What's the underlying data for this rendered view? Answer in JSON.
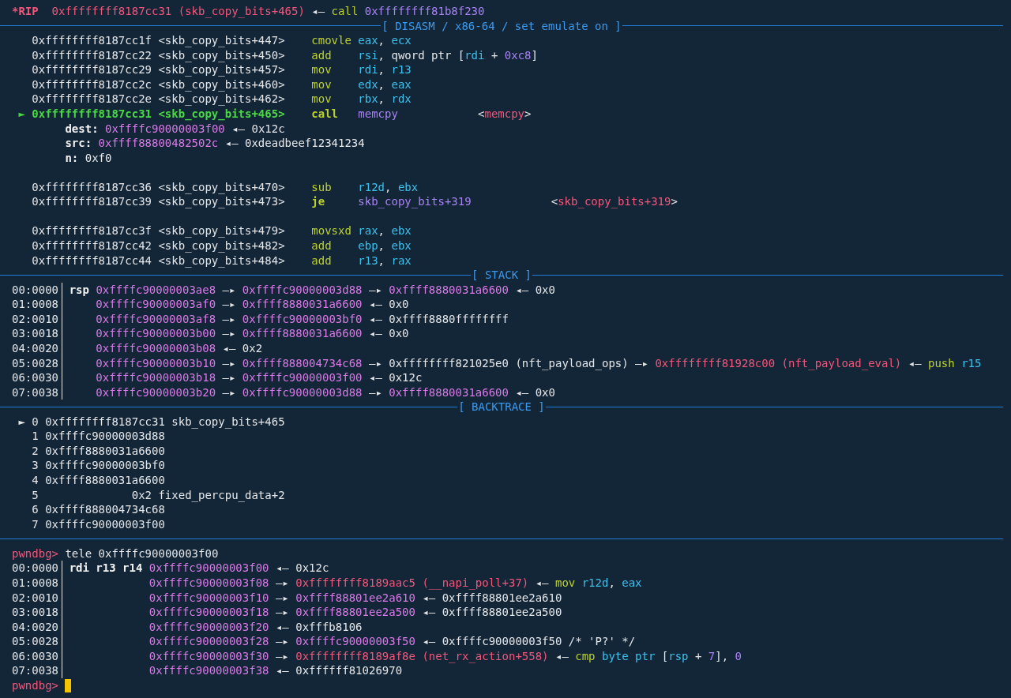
{
  "lines": [
    {
      "kind": "text",
      "segments": [
        {
          "text": "*RIP",
          "kind": "rip"
        },
        {
          "text": "  0xffffffff8187cc31 (skb_copy_bits+465)",
          "kind": "code"
        },
        {
          "text": " ◂— ",
          "kind": "plain"
        },
        {
          "text": "call",
          "kind": "mnem"
        },
        {
          "text": " 0xffffffff81b8f230",
          "kind": "imm"
        }
      ]
    },
    {
      "kind": "rule",
      "label": "[ DISASM / x86-64 / set emulate on ]"
    },
    {
      "kind": "text",
      "segments": [
        {
          "text": "   0xffffffff8187cc1f <skb_copy_bits+447>    ",
          "kind": "plain"
        },
        {
          "text": "cmovle ",
          "kind": "mnem"
        },
        {
          "text": "eax",
          "kind": "reg"
        },
        {
          "text": ", ",
          "kind": "plain"
        },
        {
          "text": "ecx",
          "kind": "reg"
        }
      ]
    },
    {
      "kind": "text",
      "segments": [
        {
          "text": "   0xffffffff8187cc22 <skb_copy_bits+450>    ",
          "kind": "plain"
        },
        {
          "text": "add    ",
          "kind": "mnem"
        },
        {
          "text": "rsi",
          "kind": "reg"
        },
        {
          "text": ", qword ptr [",
          "kind": "plain"
        },
        {
          "text": "rdi",
          "kind": "reg"
        },
        {
          "text": " + ",
          "kind": "plain"
        },
        {
          "text": "0xc8",
          "kind": "imm"
        },
        {
          "text": "]",
          "kind": "plain"
        }
      ]
    },
    {
      "kind": "text",
      "segments": [
        {
          "text": "   0xffffffff8187cc29 <skb_copy_bits+457>    ",
          "kind": "plain"
        },
        {
          "text": "mov    ",
          "kind": "mnem"
        },
        {
          "text": "rdi",
          "kind": "reg"
        },
        {
          "text": ", ",
          "kind": "plain"
        },
        {
          "text": "r13",
          "kind": "reg"
        }
      ]
    },
    {
      "kind": "text",
      "segments": [
        {
          "text": "   0xffffffff8187cc2c <skb_copy_bits+460>    ",
          "kind": "plain"
        },
        {
          "text": "mov    ",
          "kind": "mnem"
        },
        {
          "text": "edx",
          "kind": "reg"
        },
        {
          "text": ", ",
          "kind": "plain"
        },
        {
          "text": "eax",
          "kind": "reg"
        }
      ]
    },
    {
      "kind": "text",
      "segments": [
        {
          "text": "   0xffffffff8187cc2e <skb_copy_bits+462>    ",
          "kind": "plain"
        },
        {
          "text": "mov    ",
          "kind": "mnem"
        },
        {
          "text": "rbx",
          "kind": "reg"
        },
        {
          "text": ", ",
          "kind": "plain"
        },
        {
          "text": "rdx",
          "kind": "reg"
        }
      ]
    },
    {
      "kind": "text",
      "segments": [
        {
          "text": " ► 0xffffffff8187cc31 <skb_copy_bits+465>    ",
          "kind": "current"
        },
        {
          "text": "call   ",
          "kind": "mnembold"
        },
        {
          "text": "memcpy",
          "kind": "imm"
        },
        {
          "text": "            <",
          "kind": "plain"
        },
        {
          "text": "memcpy",
          "kind": "code"
        },
        {
          "text": ">",
          "kind": "plain"
        }
      ]
    },
    {
      "kind": "text",
      "segments": [
        {
          "text": "        dest: ",
          "kind": "bold"
        },
        {
          "text": "0xffffc90000003f00",
          "kind": "stack"
        },
        {
          "text": " ◂— 0x12c",
          "kind": "plain"
        }
      ]
    },
    {
      "kind": "text",
      "segments": [
        {
          "text": "        src: ",
          "kind": "bold"
        },
        {
          "text": "0xffff88800482502c",
          "kind": "stack"
        },
        {
          "text": " ◂— 0xdeadbeef12341234",
          "kind": "plain"
        }
      ]
    },
    {
      "kind": "text",
      "segments": [
        {
          "text": "        n:",
          "kind": "bold"
        },
        {
          "text": " 0xf0",
          "kind": "plain"
        }
      ]
    },
    {
      "kind": "blank"
    },
    {
      "kind": "text",
      "segments": [
        {
          "text": "   0xffffffff8187cc36 <skb_copy_bits+470>    ",
          "kind": "plain"
        },
        {
          "text": "sub    ",
          "kind": "mnem"
        },
        {
          "text": "r12d",
          "kind": "reg"
        },
        {
          "text": ", ",
          "kind": "plain"
        },
        {
          "text": "ebx",
          "kind": "reg"
        }
      ]
    },
    {
      "kind": "text",
      "segments": [
        {
          "text": "   0xffffffff8187cc39 <skb_copy_bits+473>    ",
          "kind": "plain"
        },
        {
          "text": "je     ",
          "kind": "mnembold"
        },
        {
          "text": "skb_copy_bits+319",
          "kind": "imm"
        },
        {
          "text": "            <",
          "kind": "plain"
        },
        {
          "text": "skb_copy_bits+319",
          "kind": "code"
        },
        {
          "text": ">",
          "kind": "plain"
        }
      ]
    },
    {
      "kind": "blank"
    },
    {
      "kind": "text",
      "segments": [
        {
          "text": "   0xffffffff8187cc3f <skb_copy_bits+479>    ",
          "kind": "plain"
        },
        {
          "text": "movsxd ",
          "kind": "mnem"
        },
        {
          "text": "rax",
          "kind": "reg"
        },
        {
          "text": ", ",
          "kind": "plain"
        },
        {
          "text": "ebx",
          "kind": "reg"
        }
      ]
    },
    {
      "kind": "text",
      "segments": [
        {
          "text": "   0xffffffff8187cc42 <skb_copy_bits+482>    ",
          "kind": "plain"
        },
        {
          "text": "add    ",
          "kind": "mnem"
        },
        {
          "text": "ebp",
          "kind": "reg"
        },
        {
          "text": ", ",
          "kind": "plain"
        },
        {
          "text": "ebx",
          "kind": "reg"
        }
      ]
    },
    {
      "kind": "text",
      "segments": [
        {
          "text": "   0xffffffff8187cc44 <skb_copy_bits+484>    ",
          "kind": "plain"
        },
        {
          "text": "add    ",
          "kind": "mnem"
        },
        {
          "text": "r13",
          "kind": "reg"
        },
        {
          "text": ", ",
          "kind": "plain"
        },
        {
          "text": "rax",
          "kind": "reg"
        }
      ]
    },
    {
      "kind": "rule",
      "label": "[ STACK ]"
    },
    {
      "kind": "gutter",
      "offset": "00:0000",
      "segments": [
        {
          "text": " rsp ",
          "kind": "bold"
        },
        {
          "text": "0xffffc90000003ae8",
          "kind": "stack"
        },
        {
          "text": " —▸ ",
          "kind": "plain"
        },
        {
          "text": "0xffffc90000003d88",
          "kind": "stack"
        },
        {
          "text": " —▸ ",
          "kind": "plain"
        },
        {
          "text": "0xffff8880031a6600",
          "kind": "stack"
        },
        {
          "text": " ◂— 0x0",
          "kind": "plain"
        }
      ]
    },
    {
      "kind": "gutter",
      "offset": "01:0008",
      "segments": [
        {
          "text": "     0xffffc90000003af0",
          "kind": "stack"
        },
        {
          "text": " —▸ ",
          "kind": "plain"
        },
        {
          "text": "0xffff8880031a6600",
          "kind": "stack"
        },
        {
          "text": " ◂— 0x0",
          "kind": "plain"
        }
      ]
    },
    {
      "kind": "gutter",
      "offset": "02:0010",
      "segments": [
        {
          "text": "     0xffffc90000003af8",
          "kind": "stack"
        },
        {
          "text": " —▸ ",
          "kind": "plain"
        },
        {
          "text": "0xffffc90000003bf0",
          "kind": "stack"
        },
        {
          "text": " ◂— 0xffff8880ffffffff",
          "kind": "plain"
        }
      ]
    },
    {
      "kind": "gutter",
      "offset": "03:0018",
      "segments": [
        {
          "text": "     0xffffc90000003b00",
          "kind": "stack"
        },
        {
          "text": " —▸ ",
          "kind": "plain"
        },
        {
          "text": "0xffff8880031a6600",
          "kind": "stack"
        },
        {
          "text": " ◂— 0x0",
          "kind": "plain"
        }
      ]
    },
    {
      "kind": "gutter",
      "offset": "04:0020",
      "segments": [
        {
          "text": "     0xffffc90000003b08",
          "kind": "stack"
        },
        {
          "text": " ◂— 0x2",
          "kind": "plain"
        }
      ]
    },
    {
      "kind": "gutter",
      "offset": "05:0028",
      "segments": [
        {
          "text": "     0xffffc90000003b10",
          "kind": "stack"
        },
        {
          "text": " —▸ ",
          "kind": "plain"
        },
        {
          "text": "0xffff888004734c68",
          "kind": "stack"
        },
        {
          "text": " —▸ 0xffffffff821025e0 (nft_payload_ops) —▸ ",
          "kind": "plain"
        },
        {
          "text": "0xffffffff81928c00 (nft_payload_eval)",
          "kind": "code"
        },
        {
          "text": " ◂— ",
          "kind": "plain"
        },
        {
          "text": "push ",
          "kind": "mnem"
        },
        {
          "text": "r15",
          "kind": "reg"
        }
      ]
    },
    {
      "kind": "gutter",
      "offset": "06:0030",
      "segments": [
        {
          "text": "     0xffffc90000003b18",
          "kind": "stack"
        },
        {
          "text": " —▸ ",
          "kind": "plain"
        },
        {
          "text": "0xffffc90000003f00",
          "kind": "stack"
        },
        {
          "text": " ◂— 0x12c",
          "kind": "plain"
        }
      ]
    },
    {
      "kind": "gutter",
      "offset": "07:0038",
      "segments": [
        {
          "text": "     0xffffc90000003b20",
          "kind": "stack"
        },
        {
          "text": " —▸ ",
          "kind": "plain"
        },
        {
          "text": "0xffffc90000003d88",
          "kind": "stack"
        },
        {
          "text": " —▸ ",
          "kind": "plain"
        },
        {
          "text": "0xffff8880031a6600",
          "kind": "stack"
        },
        {
          "text": " ◂— 0x0",
          "kind": "plain"
        }
      ]
    },
    {
      "kind": "rule",
      "label": "[ BACKTRACE ]"
    },
    {
      "kind": "text",
      "segments": [
        {
          "text": " ► 0 0xffffffff8187cc31 skb_copy_bits+465",
          "kind": "plain"
        }
      ]
    },
    {
      "kind": "text",
      "segments": [
        {
          "text": "   1 0xffffc90000003d88",
          "kind": "plain"
        }
      ]
    },
    {
      "kind": "text",
      "segments": [
        {
          "text": "   2 0xffff8880031a6600",
          "kind": "plain"
        }
      ]
    },
    {
      "kind": "text",
      "segments": [
        {
          "text": "   3 0xffffc90000003bf0",
          "kind": "plain"
        }
      ]
    },
    {
      "kind": "text",
      "segments": [
        {
          "text": "   4 0xffff8880031a6600",
          "kind": "plain"
        }
      ]
    },
    {
      "kind": "text",
      "segments": [
        {
          "text": "   5              0x2 fixed_percpu_data+2",
          "kind": "plain"
        }
      ]
    },
    {
      "kind": "text",
      "segments": [
        {
          "text": "   6 0xffff888004734c68",
          "kind": "plain"
        }
      ]
    },
    {
      "kind": "text",
      "segments": [
        {
          "text": "   7 0xffffc90000003f00",
          "kind": "plain"
        }
      ]
    },
    {
      "kind": "rule"
    },
    {
      "kind": "text",
      "segments": [
        {
          "text": "pwndbg>",
          "kind": "prompt"
        },
        {
          "text": " tele 0xffffc90000003f00",
          "kind": "plain"
        }
      ]
    },
    {
      "kind": "gutter",
      "offset": "00:0000",
      "segments": [
        {
          "text": " rdi r13 r14 ",
          "kind": "bold"
        },
        {
          "text": "0xffffc90000003f00",
          "kind": "stack"
        },
        {
          "text": " ◂— 0x12c",
          "kind": "plain"
        }
      ]
    },
    {
      "kind": "gutter",
      "offset": "01:0008",
      "segments": [
        {
          "text": "             0xffffc90000003f08",
          "kind": "stack"
        },
        {
          "text": " —▸ ",
          "kind": "plain"
        },
        {
          "text": "0xffffffff8189aac5 (__napi_poll+37)",
          "kind": "code"
        },
        {
          "text": " ◂— ",
          "kind": "plain"
        },
        {
          "text": "mov ",
          "kind": "mnem"
        },
        {
          "text": "r12d",
          "kind": "reg"
        },
        {
          "text": ", ",
          "kind": "plain"
        },
        {
          "text": "eax",
          "kind": "reg"
        }
      ]
    },
    {
      "kind": "gutter",
      "offset": "02:0010",
      "segments": [
        {
          "text": "             0xffffc90000003f10",
          "kind": "stack"
        },
        {
          "text": " —▸ ",
          "kind": "plain"
        },
        {
          "text": "0xffff88801ee2a610",
          "kind": "stack"
        },
        {
          "text": " ◂— 0xffff88801ee2a610",
          "kind": "plain"
        }
      ]
    },
    {
      "kind": "gutter",
      "offset": "03:0018",
      "segments": [
        {
          "text": "             0xffffc90000003f18",
          "kind": "stack"
        },
        {
          "text": " —▸ ",
          "kind": "plain"
        },
        {
          "text": "0xffff88801ee2a500",
          "kind": "stack"
        },
        {
          "text": " ◂— 0xffff88801ee2a500",
          "kind": "plain"
        }
      ]
    },
    {
      "kind": "gutter",
      "offset": "04:0020",
      "segments": [
        {
          "text": "             0xffffc90000003f20",
          "kind": "stack"
        },
        {
          "text": " ◂— 0xfffb8106",
          "kind": "plain"
        }
      ]
    },
    {
      "kind": "gutter",
      "offset": "05:0028",
      "segments": [
        {
          "text": "             0xffffc90000003f28",
          "kind": "stack"
        },
        {
          "text": " —▸ ",
          "kind": "plain"
        },
        {
          "text": "0xffffc90000003f50",
          "kind": "stack"
        },
        {
          "text": " ◂— 0xffffc90000003f50 /* 'P?' */",
          "kind": "plain"
        }
      ]
    },
    {
      "kind": "gutter",
      "offset": "06:0030",
      "segments": [
        {
          "text": "             0xffffc90000003f30",
          "kind": "stack"
        },
        {
          "text": " —▸ ",
          "kind": "plain"
        },
        {
          "text": "0xffffffff8189af8e (net_rx_action+558)",
          "kind": "code"
        },
        {
          "text": " ◂— ",
          "kind": "plain"
        },
        {
          "text": "cmp ",
          "kind": "mnem"
        },
        {
          "text": "byte ptr",
          "kind": "reg"
        },
        {
          "text": " [",
          "kind": "plain"
        },
        {
          "text": "rsp",
          "kind": "reg"
        },
        {
          "text": " + ",
          "kind": "plain"
        },
        {
          "text": "7",
          "kind": "imm"
        },
        {
          "text": "], ",
          "kind": "plain"
        },
        {
          "text": "0",
          "kind": "imm"
        }
      ]
    },
    {
      "kind": "gutter",
      "offset": "07:0038",
      "segments": [
        {
          "text": "             0xffffc90000003f38",
          "kind": "stack"
        },
        {
          "text": " ◂— 0xffffff81026970",
          "kind": "plain"
        }
      ]
    },
    {
      "kind": "text",
      "cursor": true,
      "segments": [
        {
          "text": "pwndbg> ",
          "kind": "prompt"
        }
      ]
    }
  ]
}
